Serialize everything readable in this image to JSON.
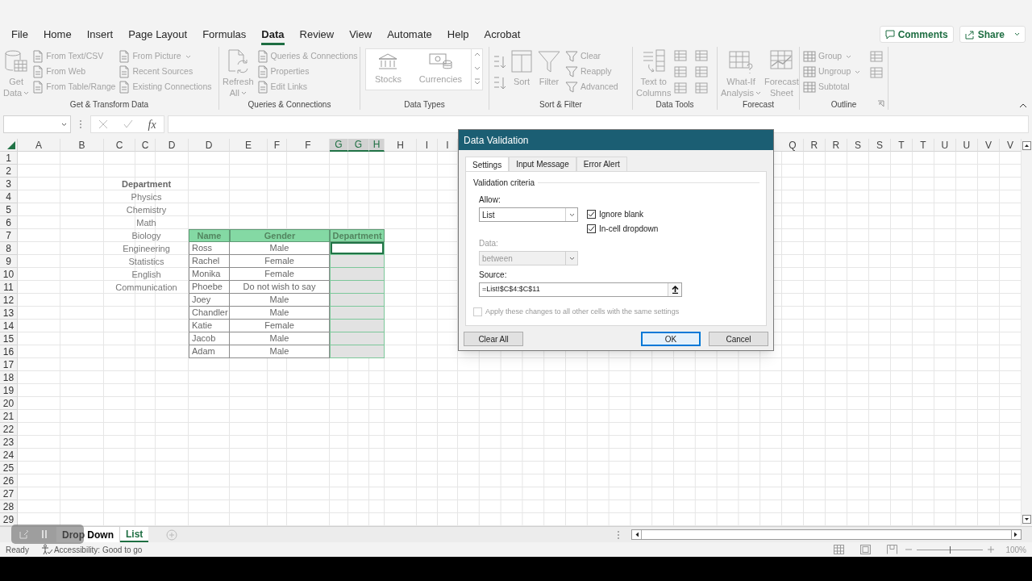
{
  "menu_tabs": [
    {
      "label": "File",
      "selected": false
    },
    {
      "label": "Home",
      "selected": false
    },
    {
      "label": "Insert",
      "selected": false
    },
    {
      "label": "Page Layout",
      "selected": false
    },
    {
      "label": "Formulas",
      "selected": false
    },
    {
      "label": "Data",
      "selected": true
    },
    {
      "label": "Review",
      "selected": false
    },
    {
      "label": "View",
      "selected": false
    },
    {
      "label": "Automate",
      "selected": false
    },
    {
      "label": "Help",
      "selected": false
    },
    {
      "label": "Acrobat",
      "selected": false
    }
  ],
  "header_buttons": [
    {
      "label": "Comments",
      "kind": "comments"
    },
    {
      "label": "Share",
      "kind": "share"
    }
  ],
  "ribbon": {
    "groups": [
      {
        "label": "Get & Transform Data",
        "launcher": false,
        "items": [
          {
            "kind": "large",
            "lines": [
              "Get",
              "Data"
            ],
            "dropdown": true
          },
          {
            "kind": "stack",
            "items": [
              {
                "label": "From Text/CSV",
                "dropdown": false
              },
              {
                "label": "From Web",
                "dropdown": false
              },
              {
                "label": "From Table/Range",
                "dropdown": false
              }
            ]
          },
          {
            "kind": "stack",
            "items": [
              {
                "label": "From Picture",
                "dropdown": true
              },
              {
                "label": "Recent Sources",
                "dropdown": false
              },
              {
                "label": "Existing Connections",
                "dropdown": false
              }
            ]
          }
        ]
      },
      {
        "label": "Queries & Connections",
        "launcher": false,
        "items": [
          {
            "kind": "large",
            "lines": [
              "Refresh",
              "All"
            ],
            "dropdown": true
          },
          {
            "kind": "stack",
            "items": [
              {
                "label": "Queries & Connections",
                "dropdown": false
              },
              {
                "label": "Properties",
                "dropdown": false
              },
              {
                "label": "Edit Links",
                "dropdown": false
              }
            ]
          }
        ]
      },
      {
        "label": "Data Types",
        "launcher": false,
        "items": [
          {
            "kind": "gallery",
            "items": [
              "Stocks",
              "Currencies"
            ]
          }
        ]
      },
      {
        "label": "Sort & Filter",
        "launcher": false,
        "items": [
          {
            "kind": "sort_buttons"
          },
          {
            "kind": "large",
            "lines": [
              "Sort"
            ],
            "dropdown": false
          },
          {
            "kind": "large",
            "lines": [
              "Filter"
            ],
            "dropdown": false
          },
          {
            "kind": "stack",
            "items": [
              {
                "label": "Clear",
                "dropdown": false
              },
              {
                "label": "Reapply",
                "dropdown": false
              },
              {
                "label": "Advanced",
                "dropdown": false
              }
            ]
          }
        ]
      },
      {
        "label": "Data Tools",
        "launcher": false,
        "items": [
          {
            "kind": "large",
            "lines": [
              "Text to",
              "Columns"
            ],
            "dropdown": false
          },
          {
            "kind": "tool_buttons"
          }
        ]
      },
      {
        "label": "Forecast",
        "launcher": false,
        "items": [
          {
            "kind": "large",
            "lines": [
              "What-If",
              "Analysis"
            ],
            "dropdown": true
          },
          {
            "kind": "large",
            "lines": [
              "Forecast",
              "Sheet"
            ],
            "dropdown": false
          }
        ]
      },
      {
        "label": "Outline",
        "launcher": true,
        "items": [
          {
            "kind": "stack",
            "items": [
              {
                "label": "Group",
                "dropdown": true
              },
              {
                "label": "Ungroup",
                "dropdown": true
              },
              {
                "label": "Subtotal",
                "dropdown": false
              }
            ]
          },
          {
            "kind": "outline_buttons"
          }
        ]
      }
    ]
  },
  "formula_bar": {
    "function_label": "fx"
  },
  "sheet": {
    "columns": [
      {
        "label": "A",
        "selected": false
      },
      {
        "label": "B",
        "selected": false
      },
      {
        "label": "C",
        "selected": false
      },
      {
        "label": "C",
        "selected": false
      },
      {
        "label": "D",
        "selected": false
      },
      {
        "label": "D",
        "selected": false
      },
      {
        "label": "E",
        "selected": false
      },
      {
        "label": "F",
        "selected": false
      },
      {
        "label": "F",
        "selected": false
      },
      {
        "label": "G",
        "selected": true
      },
      {
        "label": "G",
        "selected": true
      },
      {
        "label": "H",
        "selected": true
      },
      {
        "label": "H",
        "selected": false
      },
      {
        "label": "I",
        "selected": false
      },
      {
        "label": "I",
        "selected": false
      }
    ],
    "right_columns": [
      {
        "label": "Q",
        "selected": false
      },
      {
        "label": "R",
        "selected": false
      },
      {
        "label": "R",
        "selected": false
      },
      {
        "label": "S",
        "selected": false
      },
      {
        "label": "S",
        "selected": false
      },
      {
        "label": "T",
        "selected": false
      },
      {
        "label": "T",
        "selected": false
      },
      {
        "label": "U",
        "selected": false
      },
      {
        "label": "U",
        "selected": false
      },
      {
        "label": "V",
        "selected": false
      },
      {
        "label": "V",
        "selected": false
      }
    ],
    "row_numbers": [
      "1",
      "2",
      "3",
      "4",
      "5",
      "6",
      "7",
      "8",
      "9",
      "10",
      "11",
      "12",
      "13",
      "14",
      "15",
      "16",
      "17",
      "18",
      "19",
      "20",
      "21",
      "22",
      "23",
      "24",
      "25",
      "26",
      "27",
      "28",
      "29"
    ],
    "list": {
      "header": "Department",
      "items": [
        "Physics",
        "Chemistry",
        "Math",
        "Biology",
        "Engineering",
        "Statistics",
        "English",
        "Communication"
      ]
    },
    "table": {
      "columns": [
        "Name",
        "Gender",
        "Department"
      ],
      "rows": [
        {
          "name": "Ross",
          "gender": "Male",
          "selected": true,
          "active": true
        },
        {
          "name": "Rachel",
          "gender": "Female",
          "selected": true,
          "active": false
        },
        {
          "name": "Monika",
          "gender": "Female",
          "selected": true,
          "active": false
        },
        {
          "name": "Phoebe",
          "gender": "Do not wish to say",
          "selected": true,
          "active": false
        },
        {
          "name": "Joey",
          "gender": "Male",
          "selected": true,
          "active": false
        },
        {
          "name": "Chandler",
          "gender": "Male",
          "selected": true,
          "active": false
        },
        {
          "name": "Katie",
          "gender": "Female",
          "selected": true,
          "active": false
        },
        {
          "name": "Jacob",
          "gender": "Male",
          "selected": true,
          "active": false
        },
        {
          "name": "Adam",
          "gender": "Male",
          "selected": true,
          "active": false
        }
      ]
    }
  },
  "dialog": {
    "title": "Data Validation",
    "tabs": [
      {
        "label": "Settings",
        "selected": true
      },
      {
        "label": "Input Message",
        "selected": false
      },
      {
        "label": "Error Alert",
        "selected": false
      }
    ],
    "section": "Validation criteria",
    "allow": {
      "label": "Allow:",
      "value": "List"
    },
    "checkboxes": [
      {
        "label": "Ignore blank",
        "checked": true
      },
      {
        "label": "In-cell dropdown",
        "checked": true
      }
    ],
    "data": {
      "label": "Data:",
      "value": "between",
      "disabled": true
    },
    "source": {
      "label": "Source:",
      "value": "=List!$C$4:$C$11"
    },
    "apply_all": {
      "label": "Apply these changes to all other cells with the same settings",
      "checked": false,
      "disabled": true
    },
    "buttons": [
      {
        "label": "Clear All",
        "kind": "clear"
      },
      {
        "label": "OK",
        "kind": "default"
      },
      {
        "label": "Cancel",
        "kind": "cancel"
      }
    ]
  },
  "sheet_tabs": [
    {
      "label": "Drop Down",
      "selected": false
    },
    {
      "label": "List",
      "selected": true
    }
  ],
  "status_bar": {
    "mode": "Ready",
    "accessibility": "Accessibility: Good to go",
    "zoom": {
      "level": 0.5,
      "reading": "100%"
    }
  }
}
